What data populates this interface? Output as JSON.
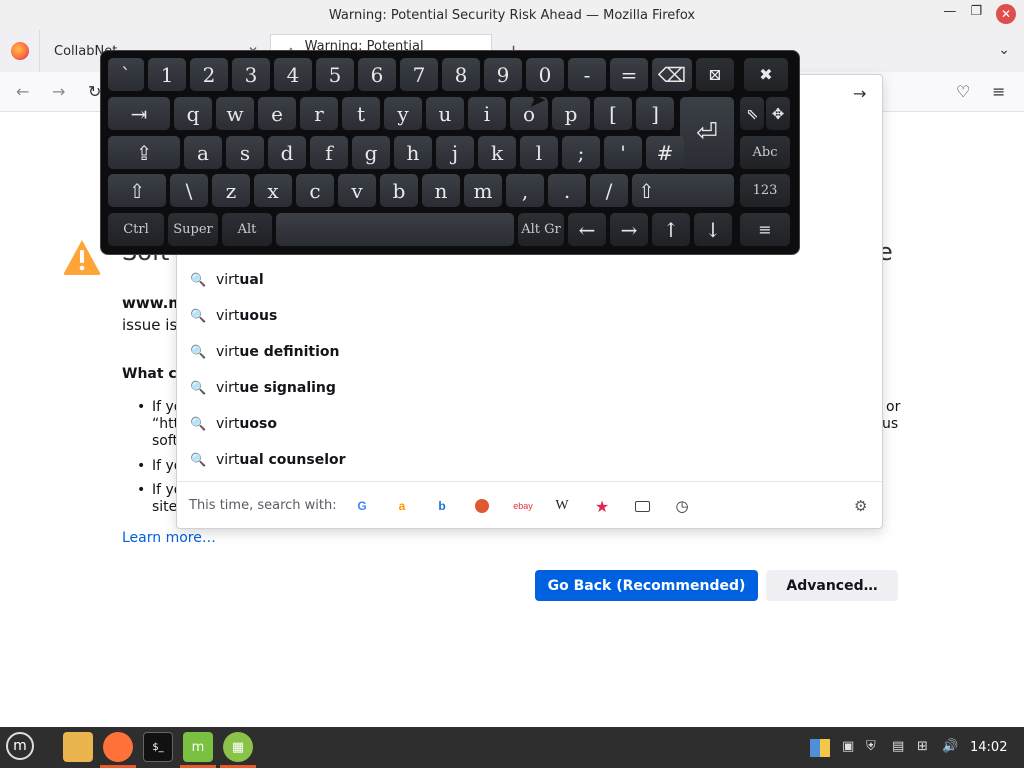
{
  "window": {
    "title": "Warning: Potential Security Risk Ahead — Mozilla Firefox",
    "controls": [
      "minimize-icon",
      "maximize-icon",
      "close-icon"
    ]
  },
  "tabs": [
    {
      "label": "CollabNet"
    },
    {
      "label": "Warning: Potential Security"
    }
  ],
  "page": {
    "title_left": "Soft",
    "title_right": "e",
    "host_prefix": "www.m",
    "issue_prefix": "issue is",
    "what_prefix": "What ca",
    "bullets": [
      "If yo",
      "“htt",
      "soft",
      "If yo",
      "If yo",
      "site"
    ],
    "right_fragments": [
      "or",
      "us"
    ],
    "learn_more": "Learn more…",
    "go_back": "Go Back (Recommended)",
    "advanced": "Advanced…",
    "accent_color": "#0061e0"
  },
  "suggestions": [
    {
      "typed": "virt",
      "rest": "ual"
    },
    {
      "typed": "virt",
      "rest": "uous"
    },
    {
      "typed": "virt",
      "rest": "ue definition"
    },
    {
      "typed": "virt",
      "rest": "ue signaling"
    },
    {
      "typed": "virt",
      "rest": "uoso"
    },
    {
      "typed": "virt",
      "rest": "ual counselor"
    }
  ],
  "search_with": {
    "label": "This time, search with:",
    "engines": [
      "google-icon",
      "amazon-icon",
      "bing-icon",
      "duckduckgo-icon",
      "ebay-icon",
      "wikipedia-icon",
      "bookmarks-icon",
      "tabs-icon",
      "history-icon"
    ],
    "ebay_text": "ebay",
    "wiki_text": "W"
  },
  "keyboard": {
    "row1": [
      "`",
      "1",
      "2",
      "3",
      "4",
      "5",
      "6",
      "7",
      "8",
      "9",
      "0",
      "-",
      "="
    ],
    "row2": [
      "q",
      "w",
      "e",
      "r",
      "t",
      "y",
      "u",
      "i",
      "o",
      "p",
      "[",
      "]"
    ],
    "row3": [
      "a",
      "s",
      "d",
      "f",
      "g",
      "h",
      "j",
      "k",
      "l",
      ";",
      "'",
      "#"
    ],
    "row4": [
      "\\",
      "z",
      "x",
      "c",
      "v",
      "b",
      "n",
      "m",
      ",",
      ".",
      "/"
    ],
    "tab": "⇥",
    "caps": "⇪",
    "shift": "⇧",
    "enter": "⏎",
    "backspace": "⌫",
    "abc": "Abc",
    "num": "123",
    "ctrl": "Ctrl",
    "super": "Super",
    "alt": "Alt",
    "altgr": "Alt Gr",
    "left": "←",
    "right": "→",
    "up": "↑",
    "down": "↓",
    "menu": "≡"
  },
  "taskbar": {
    "clock": "14:02"
  }
}
